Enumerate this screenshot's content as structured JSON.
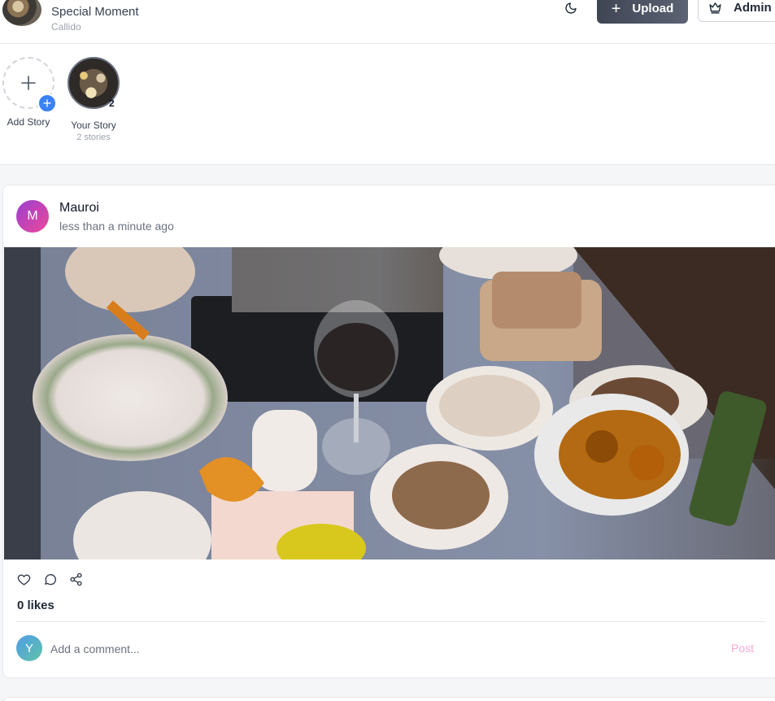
{
  "header": {
    "album_title": "Special Moment",
    "album_subtitle": "Callido",
    "upload_label": "Upload",
    "admin_label": "Admin"
  },
  "stories": {
    "add_label": "Add Story",
    "your_label": "Your Story",
    "your_sub": "2 stories",
    "your_count": "2"
  },
  "post": {
    "author_initial": "M",
    "author_name": "Mauroi",
    "time": "less than a minute ago",
    "likes": "0 likes",
    "commenter_initial": "Y",
    "comment_placeholder": "Add a comment...",
    "post_label": "Post"
  },
  "colors": {
    "accent": "#3b82f6",
    "upload_bg": "#4b5262",
    "post_disabled": "#f9a8d4"
  },
  "icons": {
    "theme": "moon-icon",
    "upload": "plus-icon",
    "admin": "crown-icon",
    "like": "heart-icon",
    "comment": "comment-icon",
    "share": "share-icon"
  }
}
